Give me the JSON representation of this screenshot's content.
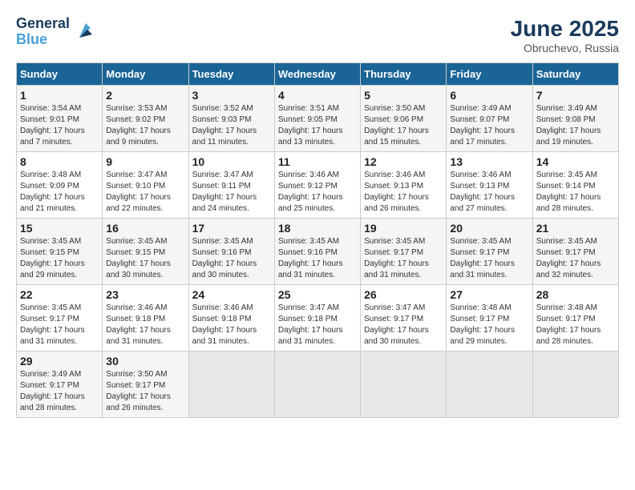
{
  "header": {
    "logo_line1": "General",
    "logo_line2": "Blue",
    "month_year": "June 2025",
    "location": "Obruchevo, Russia"
  },
  "columns": [
    "Sunday",
    "Monday",
    "Tuesday",
    "Wednesday",
    "Thursday",
    "Friday",
    "Saturday"
  ],
  "weeks": [
    [
      {
        "day": "1",
        "info": "Sunrise: 3:54 AM\nSunset: 9:01 PM\nDaylight: 17 hours\nand 7 minutes."
      },
      {
        "day": "2",
        "info": "Sunrise: 3:53 AM\nSunset: 9:02 PM\nDaylight: 17 hours\nand 9 minutes."
      },
      {
        "day": "3",
        "info": "Sunrise: 3:52 AM\nSunset: 9:03 PM\nDaylight: 17 hours\nand 11 minutes."
      },
      {
        "day": "4",
        "info": "Sunrise: 3:51 AM\nSunset: 9:05 PM\nDaylight: 17 hours\nand 13 minutes."
      },
      {
        "day": "5",
        "info": "Sunrise: 3:50 AM\nSunset: 9:06 PM\nDaylight: 17 hours\nand 15 minutes."
      },
      {
        "day": "6",
        "info": "Sunrise: 3:49 AM\nSunset: 9:07 PM\nDaylight: 17 hours\nand 17 minutes."
      },
      {
        "day": "7",
        "info": "Sunrise: 3:49 AM\nSunset: 9:08 PM\nDaylight: 17 hours\nand 19 minutes."
      }
    ],
    [
      {
        "day": "8",
        "info": "Sunrise: 3:48 AM\nSunset: 9:09 PM\nDaylight: 17 hours\nand 21 minutes."
      },
      {
        "day": "9",
        "info": "Sunrise: 3:47 AM\nSunset: 9:10 PM\nDaylight: 17 hours\nand 22 minutes."
      },
      {
        "day": "10",
        "info": "Sunrise: 3:47 AM\nSunset: 9:11 PM\nDaylight: 17 hours\nand 24 minutes."
      },
      {
        "day": "11",
        "info": "Sunrise: 3:46 AM\nSunset: 9:12 PM\nDaylight: 17 hours\nand 25 minutes."
      },
      {
        "day": "12",
        "info": "Sunrise: 3:46 AM\nSunset: 9:13 PM\nDaylight: 17 hours\nand 26 minutes."
      },
      {
        "day": "13",
        "info": "Sunrise: 3:46 AM\nSunset: 9:13 PM\nDaylight: 17 hours\nand 27 minutes."
      },
      {
        "day": "14",
        "info": "Sunrise: 3:45 AM\nSunset: 9:14 PM\nDaylight: 17 hours\nand 28 minutes."
      }
    ],
    [
      {
        "day": "15",
        "info": "Sunrise: 3:45 AM\nSunset: 9:15 PM\nDaylight: 17 hours\nand 29 minutes."
      },
      {
        "day": "16",
        "info": "Sunrise: 3:45 AM\nSunset: 9:15 PM\nDaylight: 17 hours\nand 30 minutes."
      },
      {
        "day": "17",
        "info": "Sunrise: 3:45 AM\nSunset: 9:16 PM\nDaylight: 17 hours\nand 30 minutes."
      },
      {
        "day": "18",
        "info": "Sunrise: 3:45 AM\nSunset: 9:16 PM\nDaylight: 17 hours\nand 31 minutes."
      },
      {
        "day": "19",
        "info": "Sunrise: 3:45 AM\nSunset: 9:17 PM\nDaylight: 17 hours\nand 31 minutes."
      },
      {
        "day": "20",
        "info": "Sunrise: 3:45 AM\nSunset: 9:17 PM\nDaylight: 17 hours\nand 31 minutes."
      },
      {
        "day": "21",
        "info": "Sunrise: 3:45 AM\nSunset: 9:17 PM\nDaylight: 17 hours\nand 32 minutes."
      }
    ],
    [
      {
        "day": "22",
        "info": "Sunrise: 3:45 AM\nSunset: 9:17 PM\nDaylight: 17 hours\nand 31 minutes."
      },
      {
        "day": "23",
        "info": "Sunrise: 3:46 AM\nSunset: 9:18 PM\nDaylight: 17 hours\nand 31 minutes."
      },
      {
        "day": "24",
        "info": "Sunrise: 3:46 AM\nSunset: 9:18 PM\nDaylight: 17 hours\nand 31 minutes."
      },
      {
        "day": "25",
        "info": "Sunrise: 3:47 AM\nSunset: 9:18 PM\nDaylight: 17 hours\nand 31 minutes."
      },
      {
        "day": "26",
        "info": "Sunrise: 3:47 AM\nSunset: 9:17 PM\nDaylight: 17 hours\nand 30 minutes."
      },
      {
        "day": "27",
        "info": "Sunrise: 3:48 AM\nSunset: 9:17 PM\nDaylight: 17 hours\nand 29 minutes."
      },
      {
        "day": "28",
        "info": "Sunrise: 3:48 AM\nSunset: 9:17 PM\nDaylight: 17 hours\nand 28 minutes."
      }
    ],
    [
      {
        "day": "29",
        "info": "Sunrise: 3:49 AM\nSunset: 9:17 PM\nDaylight: 17 hours\nand 28 minutes."
      },
      {
        "day": "30",
        "info": "Sunrise: 3:50 AM\nSunset: 9:17 PM\nDaylight: 17 hours\nand 26 minutes."
      },
      {
        "day": "",
        "info": ""
      },
      {
        "day": "",
        "info": ""
      },
      {
        "day": "",
        "info": ""
      },
      {
        "day": "",
        "info": ""
      },
      {
        "day": "",
        "info": ""
      }
    ]
  ]
}
